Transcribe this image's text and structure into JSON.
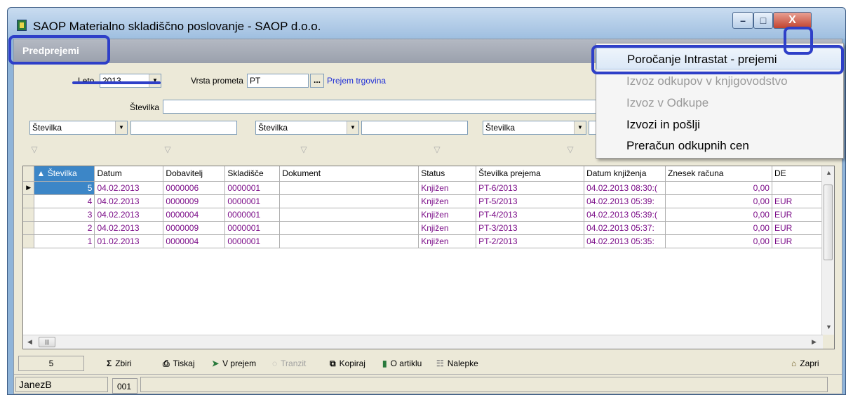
{
  "window": {
    "title": "SAOP Materialno skladiščno poslovanje - SAOP d.o.o.",
    "minimize": "–",
    "maximize": "□",
    "close": "X"
  },
  "tab": {
    "label": "Predprejemi"
  },
  "filters": {
    "leto_label": "Leto",
    "leto_value": "2013",
    "vrsta_label": "Vrsta prometa",
    "vrsta_value": "PT",
    "vrsta_dots": "...",
    "vrsta_link": "Prejem trgovina",
    "stevilka_label": "Številka",
    "stevilka_value": "",
    "criteria": [
      {
        "field": "Številka",
        "value": ""
      },
      {
        "field": "Številka",
        "value": ""
      },
      {
        "field": "Številka",
        "value": ""
      }
    ]
  },
  "grid": {
    "columns": [
      "Številka",
      "Datum",
      "Dobavitelj",
      "Skladišče",
      "Dokument",
      "Status",
      "Številka prejema",
      "Datum knjiženja",
      "Znesek računa",
      "DE"
    ],
    "rows": [
      [
        "5",
        "04.02.2013",
        "0000006",
        "0000001",
        "",
        "Knjižen",
        "PT-6/2013",
        "04.02.2013 08:30:(",
        "0,00",
        ""
      ],
      [
        "4",
        "04.02.2013",
        "0000009",
        "0000001",
        "",
        "Knjižen",
        "PT-5/2013",
        "04.02.2013 05:39:",
        "0,00",
        "EUR"
      ],
      [
        "3",
        "04.02.2013",
        "0000004",
        "0000001",
        "",
        "Knjižen",
        "PT-4/2013",
        "04.02.2013 05:39:(",
        "0,00",
        "EUR"
      ],
      [
        "2",
        "04.02.2013",
        "0000009",
        "0000001",
        "",
        "Knjižen",
        "PT-3/2013",
        "04.02.2013 05:37:",
        "0,00",
        "EUR"
      ],
      [
        "1",
        "01.02.2013",
        "0000004",
        "0000001",
        "",
        "Knjižen",
        "PT-2/2013",
        "04.02.2013 05:35:",
        "0,00",
        "EUR"
      ]
    ]
  },
  "toolbar": {
    "count": "5",
    "zbiri": "Zbiri",
    "tiskaj": "Tiskaj",
    "v_prejem": "V prejem",
    "tranzit": "Tranzit",
    "kopiraj": "Kopiraj",
    "o_artiklu": "O artiklu",
    "nalepke": "Nalepke",
    "zapri": "Zapri"
  },
  "status": {
    "user": "JanezB",
    "code": "001"
  },
  "popup_menu": [
    {
      "label": "Poročanje Intrastat - prejemi",
      "enabled": true
    },
    {
      "label": "Izvoz odkupov v knjigovodstvo",
      "enabled": false
    },
    {
      "label": "Izvoz v Odkupe",
      "enabled": false
    },
    {
      "label": "Izvozi in pošlji",
      "enabled": true
    },
    {
      "label": "Preračun odkupnih cen",
      "enabled": true
    }
  ],
  "colors": {
    "accent": "#3c86c7",
    "row_text": "#7b0d88",
    "annotation": "#2e3fc8",
    "link": "#1f2fd6"
  }
}
